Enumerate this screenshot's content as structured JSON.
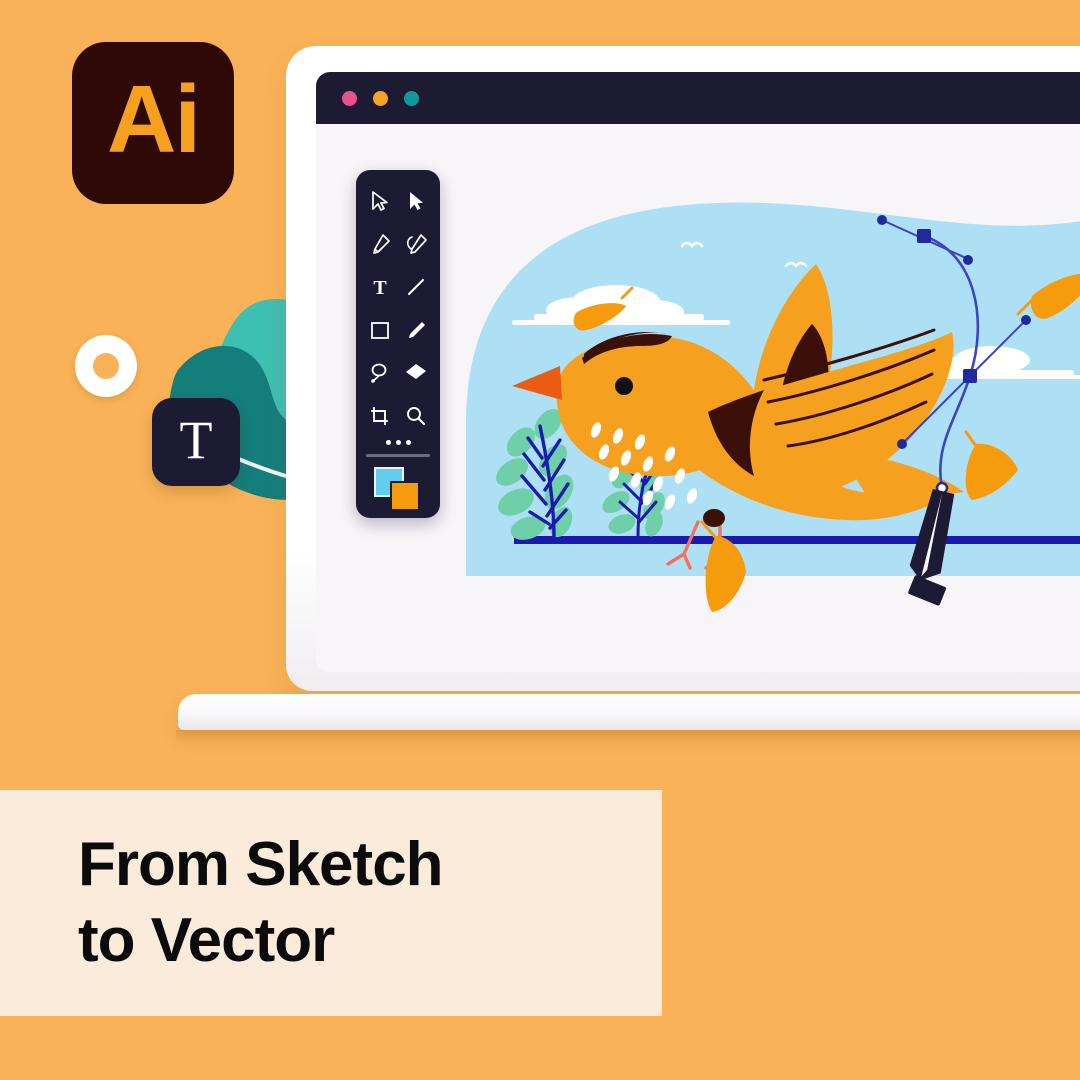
{
  "background_color": "#F9B257",
  "brand": {
    "logo_label": "Ai",
    "logo_bg": "#2E0906",
    "logo_fg": "#F5A01E",
    "app_name": "Adobe Illustrator"
  },
  "decor": {
    "ring_name": "decorative-ring",
    "blob_dark": "#147E7C",
    "blob_light": "#3FBFB2",
    "type_badge_label": "T",
    "type_badge_bg": "#1C1B33"
  },
  "laptop": {
    "titlebar": {
      "dots": [
        {
          "name": "close-dot",
          "color": "#E8508F"
        },
        {
          "name": "minimize-dot",
          "color": "#F5A322"
        },
        {
          "name": "maximize-dot",
          "color": "#0E9B9B"
        }
      ]
    },
    "canvas_bg": "#F7F5F8",
    "base_color": "#FAF8FA"
  },
  "toolbar": {
    "panel_bg": "#1C1B33",
    "overflow_label": "...",
    "tools": [
      {
        "name": "selection-tool-icon",
        "label": "Selection"
      },
      {
        "name": "direct-selection-tool-icon",
        "label": "Direct Selection"
      },
      {
        "name": "pen-tool-icon",
        "label": "Pen"
      },
      {
        "name": "curvature-tool-icon",
        "label": "Curvature"
      },
      {
        "name": "type-tool-icon",
        "label": "T"
      },
      {
        "name": "line-segment-tool-icon",
        "label": "Line Segment"
      },
      {
        "name": "rectangle-tool-icon",
        "label": "Rectangle"
      },
      {
        "name": "paintbrush-tool-icon",
        "label": "Paintbrush"
      },
      {
        "name": "lasso-tool-icon",
        "label": "Lasso"
      },
      {
        "name": "eraser-tool-icon",
        "label": "Eraser"
      },
      {
        "name": "artboard-tool-icon",
        "label": "Artboard"
      },
      {
        "name": "zoom-tool-icon",
        "label": "Zoom"
      }
    ],
    "swatches": {
      "fill_color": "#63CDF0",
      "stroke_color": "#F59B0C"
    }
  },
  "artwork": {
    "sky_color": "#AEE0F5",
    "cloud_color": "#FFFFFF",
    "bird": {
      "body_color": "#F5A01E",
      "wing_accent_color": "#3B1008",
      "beak_color": "#EA5B14",
      "eye_color": "#111111",
      "leg_color": "#F4715E",
      "speck_color": "#FFFFFF"
    },
    "plant": {
      "leaf_color": "#6FCFA8",
      "stem_color": "#1A1AAF"
    },
    "ground_line_color": "#1A1AAF",
    "feather_color": "#F59B0C",
    "path": {
      "stroke_color": "#3B45C4",
      "anchor_color": "#1F2A9B",
      "pen_cursor_color": "#1C1B33"
    }
  },
  "caption": {
    "bg": "#FBEBDB",
    "line1": "From Sketch",
    "line2": "to Vector"
  }
}
